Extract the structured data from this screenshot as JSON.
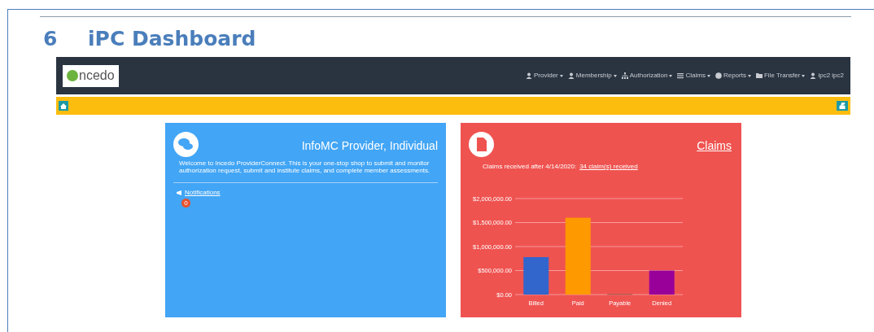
{
  "document": {
    "heading_number": "6",
    "heading": "iPC Dashboard"
  },
  "app": {
    "logo": "ncedo",
    "nav": [
      {
        "label": "Provider",
        "dropdown": true
      },
      {
        "label": "Membership",
        "dropdown": true
      },
      {
        "label": "Authorization",
        "dropdown": true
      },
      {
        "label": "Claims",
        "dropdown": true
      },
      {
        "label": "Reports",
        "dropdown": true
      },
      {
        "label": "File Transfer",
        "dropdown": true
      },
      {
        "label": "ipc2 ipc2",
        "dropdown": false
      }
    ],
    "cards": [
      {
        "kind": "welcome",
        "title": "InfoMC Provider, Individual",
        "text": "Welcome to Incedo ProviderConnect. This is your one-stop shop to submit and monitor authorization request, submit and institute claims, and complete member assessments.",
        "link": "Notifications",
        "badge": "0"
      },
      {
        "kind": "claims",
        "title": "Claims",
        "text": "Claims received after 4/14/2020:",
        "link": "34 claim(s) received",
        "chart_data": {
          "type": "bar",
          "stacked": true,
          "grid": true,
          "series": [
            {
              "name": "Billed",
              "color": "#3366cc",
              "values": [
                780000,
                null,
                null,
                null
              ]
            },
            {
              "name": "Paid",
              "color": "#ff9900",
              "values": [
                null,
                1600000,
                null,
                null
              ]
            },
            {
              "name": "Payable",
              "color": "#8b3a2a",
              "values": [
                null,
                null,
                10000,
                null
              ]
            },
            {
              "name": "Denied",
              "color": "#990099",
              "values": [
                null,
                null,
                null,
                500000
              ]
            }
          ],
          "ylim": [
            0,
            2000000
          ],
          "yticks": [
            {
              "value": 0,
              "label": "$0.00"
            },
            {
              "value": 500000,
              "label": "$500,000.00"
            },
            {
              "value": 1000000,
              "label": "$1,000,000.00"
            },
            {
              "value": 1500000,
              "label": "$1,500,000.00"
            },
            {
              "value": 2000000,
              "label": "$2,000,000.00"
            }
          ]
        }
      }
    ]
  }
}
